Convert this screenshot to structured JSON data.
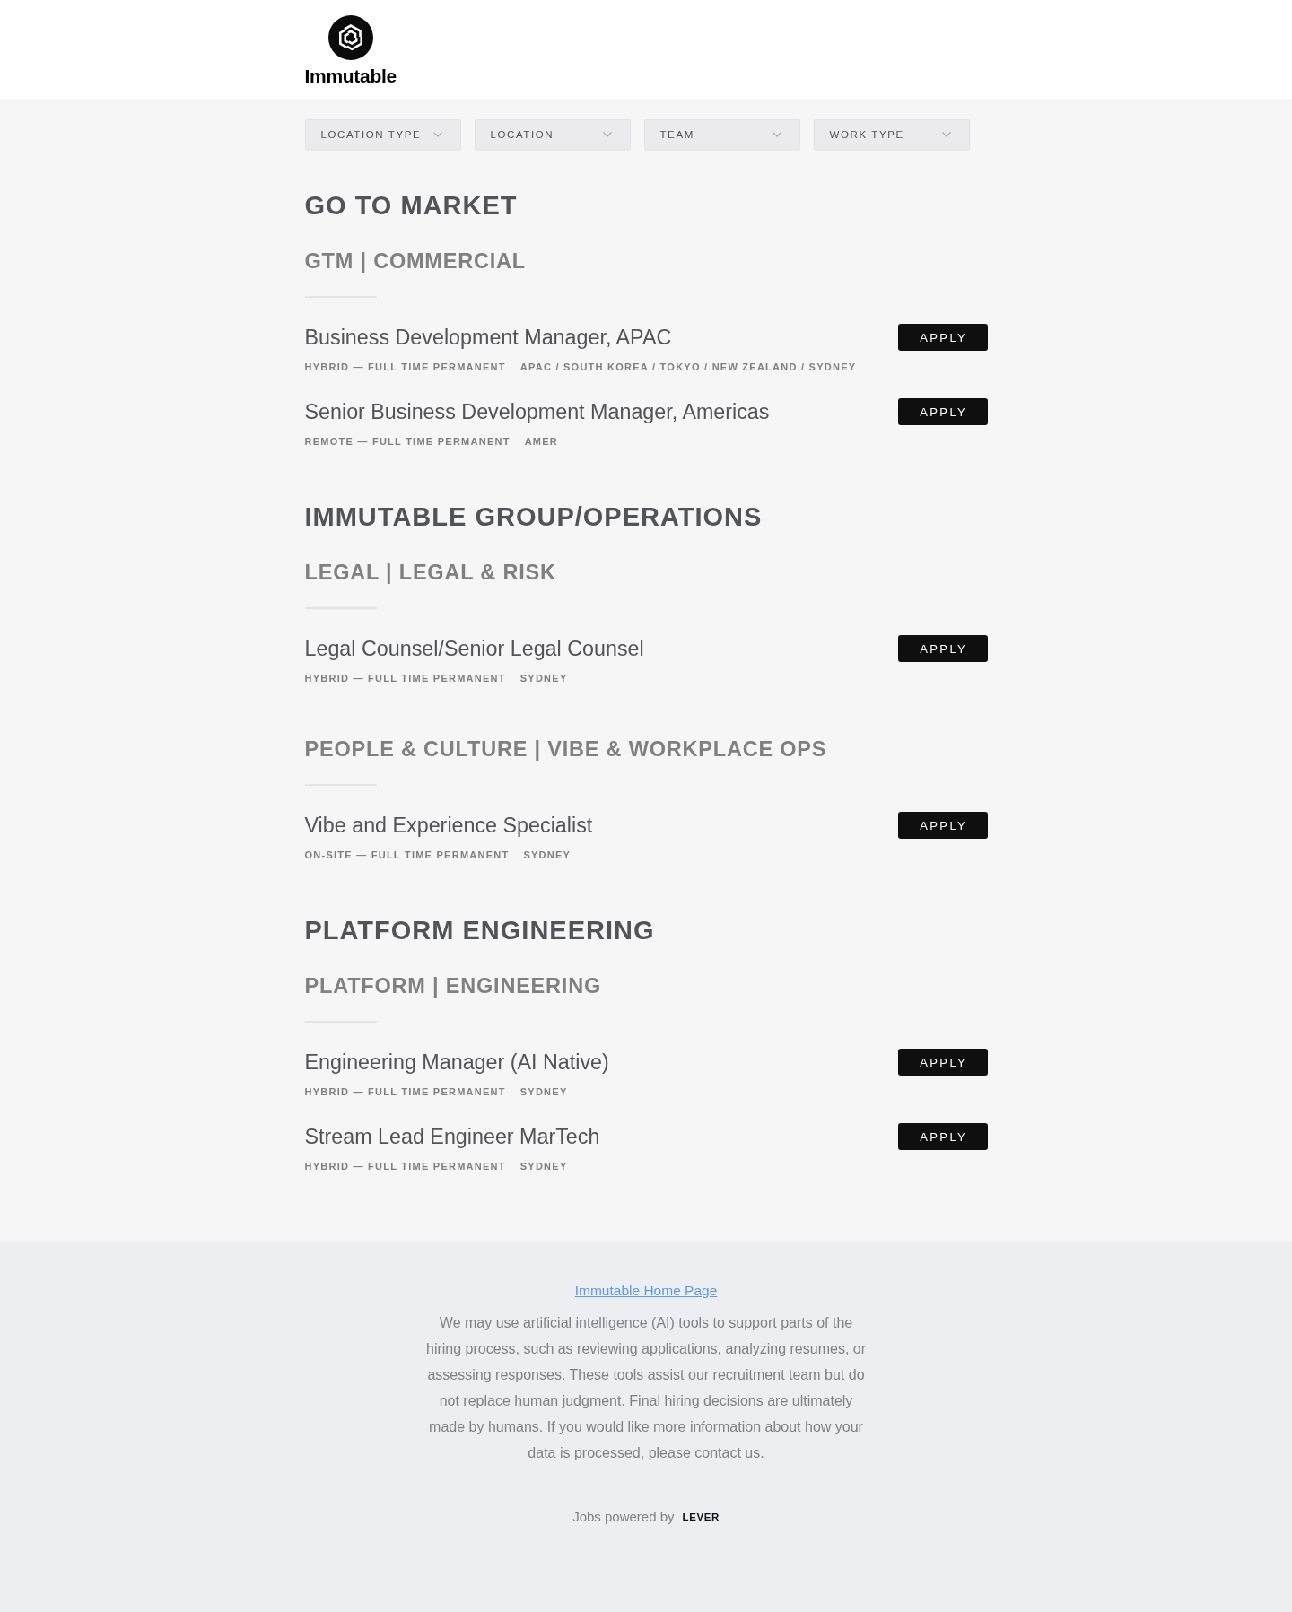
{
  "header": {
    "company_name": "Immutable"
  },
  "filters": [
    {
      "label": "LOCATION TYPE"
    },
    {
      "label": "LOCATION"
    },
    {
      "label": "TEAM"
    },
    {
      "label": "WORK TYPE"
    }
  ],
  "departments": [
    {
      "title": "GO TO MARKET",
      "teams": [
        {
          "title": "GTM | COMMERCIAL",
          "postings": [
            {
              "title": "Business Development Manager, APAC",
              "work_type": "HYBRID — FULL TIME PERMANENT",
              "location": "APAC / SOUTH KOREA / TOKYO / NEW ZEALAND / SYDNEY",
              "button": "APPLY"
            },
            {
              "title": "Senior Business Development Manager, Americas",
              "work_type": "REMOTE — FULL TIME PERMANENT",
              "location": "AMER",
              "button": "APPLY"
            }
          ]
        }
      ]
    },
    {
      "title": "IMMUTABLE GROUP/OPERATIONS",
      "teams": [
        {
          "title": "LEGAL | LEGAL & RISK",
          "postings": [
            {
              "title": "Legal Counsel/Senior Legal Counsel",
              "work_type": "HYBRID — FULL TIME PERMANENT",
              "location": "SYDNEY",
              "button": "APPLY"
            }
          ]
        },
        {
          "title": "PEOPLE & CULTURE | VIBE & WORKPLACE OPS",
          "postings": [
            {
              "title": "Vibe and Experience Specialist",
              "work_type": "ON-SITE — FULL TIME PERMANENT",
              "location": "SYDNEY",
              "button": "APPLY"
            }
          ]
        }
      ]
    },
    {
      "title": "PLATFORM ENGINEERING",
      "teams": [
        {
          "title": "PLATFORM | ENGINEERING",
          "postings": [
            {
              "title": "Engineering Manager (AI Native)",
              "work_type": "HYBRID — FULL TIME PERMANENT",
              "location": "SYDNEY",
              "button": "APPLY"
            },
            {
              "title": "Stream Lead Engineer MarTech",
              "work_type": "HYBRID — FULL TIME PERMANENT",
              "location": "SYDNEY",
              "button": "APPLY"
            }
          ]
        }
      ]
    }
  ],
  "footer": {
    "link": "Immutable Home Page",
    "disclaimer": "We may use artificial intelligence (AI) tools to support parts of the hiring process, such as reviewing applications, analyzing resumes, or assessing responses. These tools assist our recruitment team but do not replace human judgment. Final hiring decisions are ultimately made by humans. If you would like more information about how your data is processed, please contact us.",
    "powered_by": "Jobs powered by",
    "brand": "LEVER"
  }
}
